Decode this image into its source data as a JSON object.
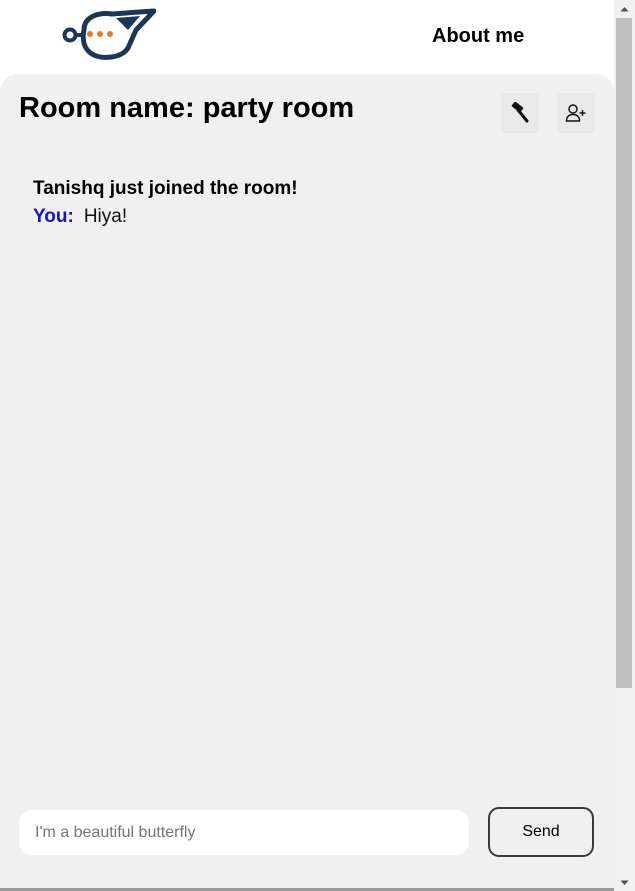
{
  "header": {
    "about_label": "About me"
  },
  "room": {
    "title_prefix": "Room name:",
    "name": "party room"
  },
  "messages": {
    "system": "Tanishq just joined the room!",
    "chat": [
      {
        "sender": "You:",
        "text": "Hiya!"
      }
    ]
  },
  "composer": {
    "value": "",
    "placeholder": "I'm a beautiful butterfly",
    "send_label": "Send"
  },
  "colors": {
    "brand_navy": "#1d3557",
    "brand_orange": "#e07a2e",
    "sender_blue": "#1616c0",
    "panel_bg": "#f0f0f0"
  },
  "icons": {
    "logo": "whistle-chat-logo",
    "kick": "hammer-icon",
    "invite": "add-user-icon"
  }
}
